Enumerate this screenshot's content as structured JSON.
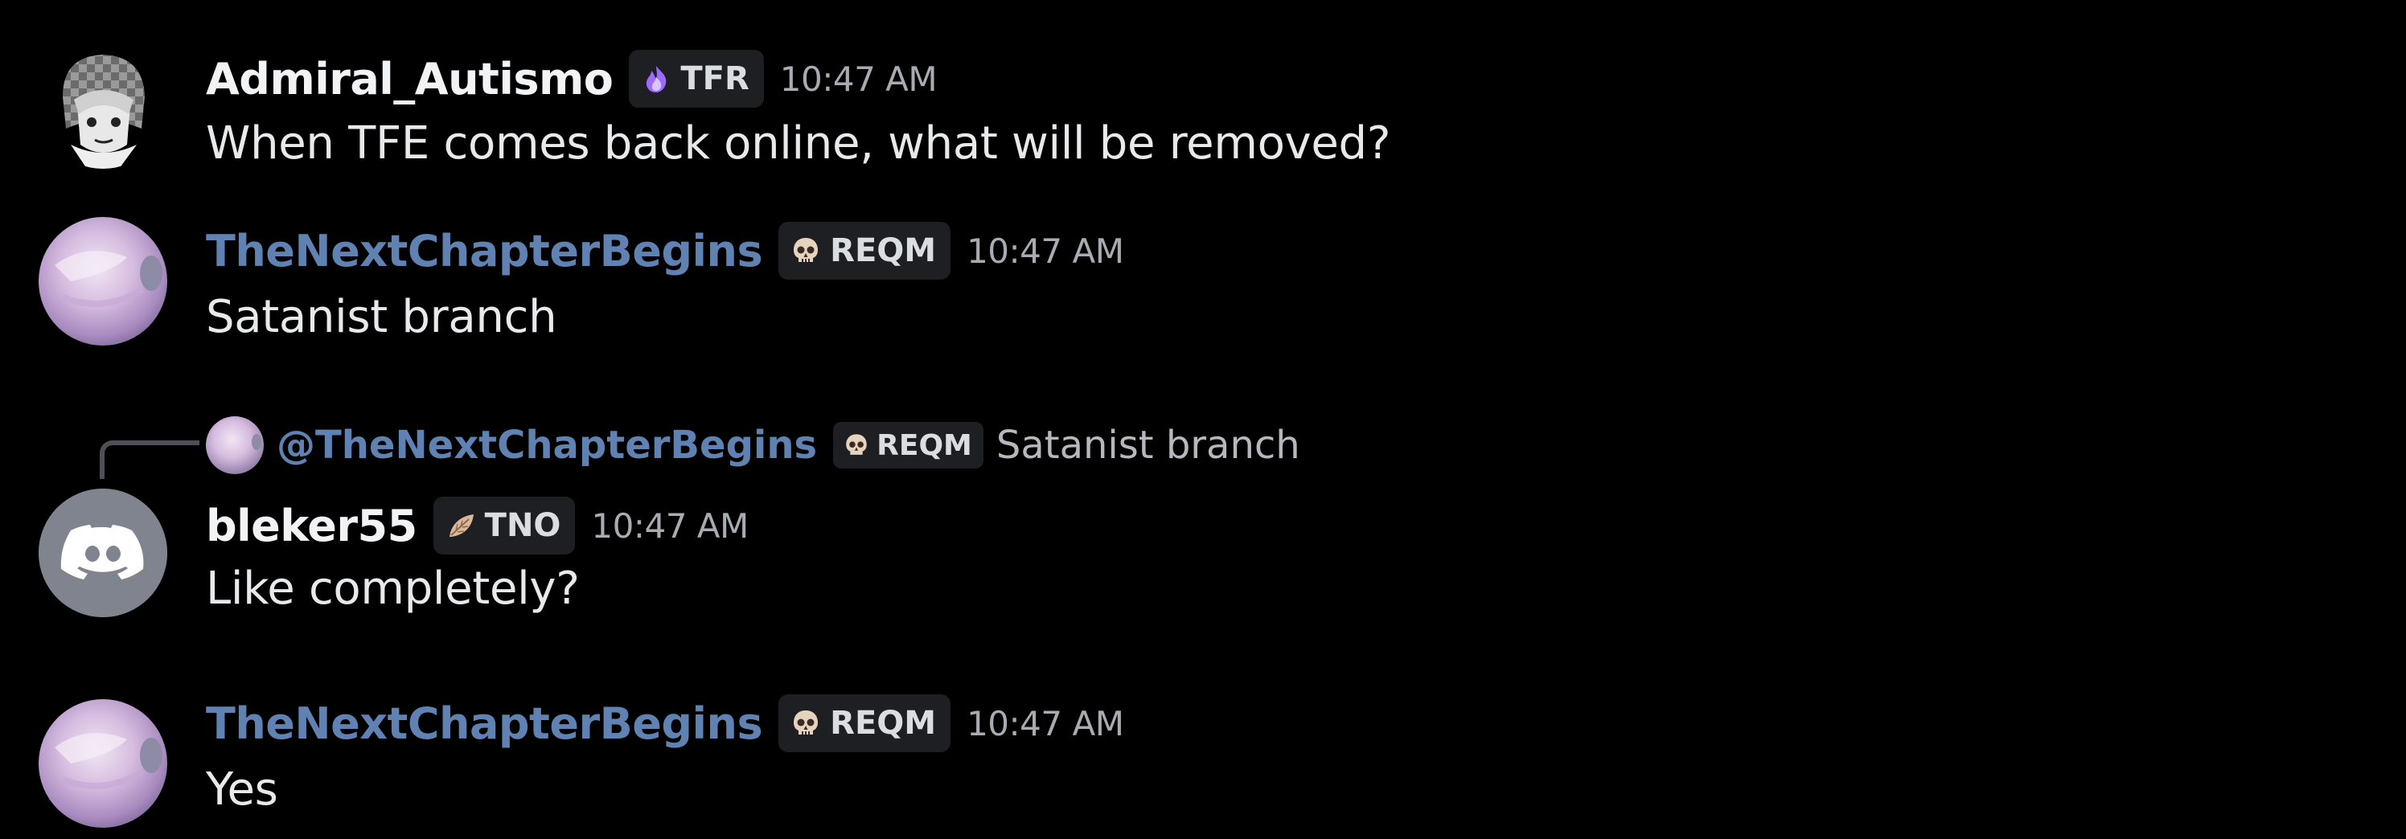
{
  "messages": [
    {
      "username": "Admiral_Autismo",
      "tag": "TFR",
      "tag_icon": "purple-flame-icon",
      "time": "10:47 AM",
      "text": "When TFE comes back online, what will be removed?"
    },
    {
      "username": "TheNextChapterBegins",
      "tag": "REQM",
      "tag_icon": "skull-icon",
      "time": "10:47 AM",
      "text": "Satanist branch"
    },
    {
      "reply": {
        "mention": "@TheNextChapterBegins",
        "tag": "REQM",
        "tag_icon": "skull-icon",
        "text": "Satanist branch"
      },
      "username": "bleker55",
      "tag": "TNO",
      "tag_icon": "leaf-icon",
      "time": "10:47 AM",
      "text": "Like completely?"
    },
    {
      "username": "TheNextChapterBegins",
      "tag": "REQM",
      "tag_icon": "skull-icon",
      "time": "10:47 AM",
      "text": "Yes"
    }
  ],
  "colors": {
    "background": "#000000",
    "username_blue": "#5f82b3",
    "tag_bg": "#1e1f22",
    "timestamp": "#a8abb2",
    "discord_default_avatar": "#80848e"
  }
}
